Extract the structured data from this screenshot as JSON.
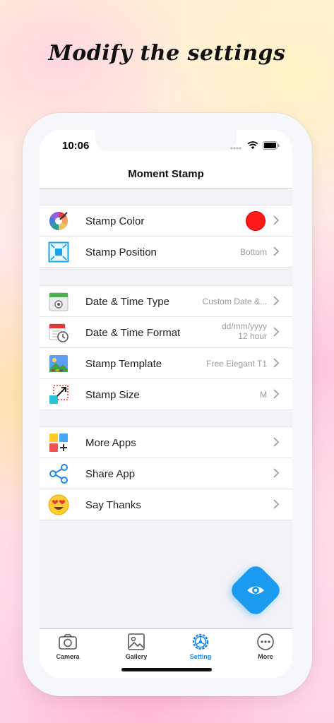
{
  "headline": "Modify the settings",
  "status_bar": {
    "time": "10:06"
  },
  "nav": {
    "title": "Moment Stamp"
  },
  "sections": [
    {
      "rows": [
        {
          "label": "Stamp Color",
          "value": "",
          "icon": "color-wheel-icon",
          "color": "#ff1a1a"
        },
        {
          "label": "Stamp Position",
          "value": "Bottom",
          "icon": "position-icon"
        }
      ]
    },
    {
      "rows": [
        {
          "label": "Date & Time Type",
          "value": "Custom Date &...",
          "icon": "calendar-camera-icon"
        },
        {
          "label": "Date & Time Format",
          "value_line1": "dd/mm/yyyy",
          "value_line2": "12 hour",
          "icon": "calendar-clock-icon"
        },
        {
          "label": "Stamp Template",
          "value": "Free Elegant T1",
          "icon": "template-icon"
        },
        {
          "label": "Stamp Size",
          "value": "M",
          "icon": "resize-icon"
        }
      ]
    },
    {
      "rows": [
        {
          "label": "More Apps",
          "value": "",
          "icon": "more-apps-icon"
        },
        {
          "label": "Share App",
          "value": "",
          "icon": "share-icon"
        },
        {
          "label": "Say Thanks",
          "value": "",
          "icon": "heart-eyes-emoji-icon"
        }
      ]
    }
  ],
  "tabs": [
    {
      "label": "Camera",
      "icon": "camera-icon",
      "active": false
    },
    {
      "label": "Gallery",
      "icon": "gallery-icon",
      "active": false
    },
    {
      "label": "Setting",
      "icon": "gear-icon",
      "active": true
    },
    {
      "label": "More",
      "icon": "more-icon",
      "active": false
    }
  ],
  "colors": {
    "accent": "#1a9bf0",
    "active_tab": "#1a86e8",
    "stamp_color": "#ff1a1a"
  }
}
